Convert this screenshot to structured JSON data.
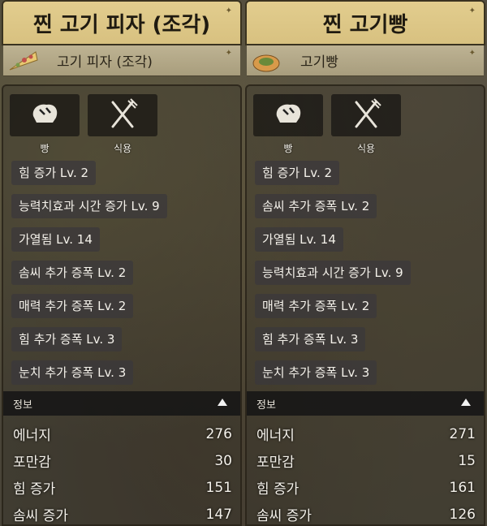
{
  "panels": [
    {
      "title": "찐 고기 피자 (조각)",
      "sub_label": "고기 피자 (조각)",
      "thumb_icon": "pizza-slice-icon",
      "buttons": [
        {
          "label": "빵",
          "icon": "bread-icon"
        },
        {
          "label": "식용",
          "icon": "fork-knife-icon"
        }
      ],
      "effects": [
        "힘 증가 Lv. 2",
        "능력치효과 시간 증가  Lv. 9",
        "가열됨 Lv. 14",
        "솜씨 추가 증폭 Lv. 2",
        "매력 추가 증폭 Lv. 2",
        "힘 추가 증폭 Lv. 3",
        "눈치 추가 증폭 Lv. 3"
      ],
      "info_header": "정보",
      "stats": [
        {
          "label": "에너지",
          "value": "276"
        },
        {
          "label": "포만감",
          "value": "30"
        },
        {
          "label": "힘 증가",
          "value": "151"
        },
        {
          "label": "솜씨 증가",
          "value": "147"
        }
      ]
    },
    {
      "title": "찐 고기빵",
      "sub_label": "고기빵",
      "thumb_icon": "meat-bun-icon",
      "buttons": [
        {
          "label": "빵",
          "icon": "bread-icon"
        },
        {
          "label": "식용",
          "icon": "fork-knife-icon"
        }
      ],
      "effects": [
        "힘 증가 Lv. 2",
        "솜씨 추가 증폭 Lv. 2",
        "가열됨 Lv. 14",
        "능력치효과 시간 증가  Lv. 9",
        "매력 추가 증폭 Lv. 2",
        "힘 추가 증폭 Lv. 3",
        "눈치 추가 증폭 Lv. 3"
      ],
      "info_header": "정보",
      "stats": [
        {
          "label": "에너지",
          "value": "271"
        },
        {
          "label": "포만감",
          "value": "15"
        },
        {
          "label": "힘 증가",
          "value": "161"
        },
        {
          "label": "솜씨 증가",
          "value": "126"
        }
      ]
    }
  ],
  "colors": {
    "title_bg": "#dcc684",
    "effect_bg": "#3a383c",
    "info_bg": "#161616",
    "text": "#f4f1ea"
  }
}
